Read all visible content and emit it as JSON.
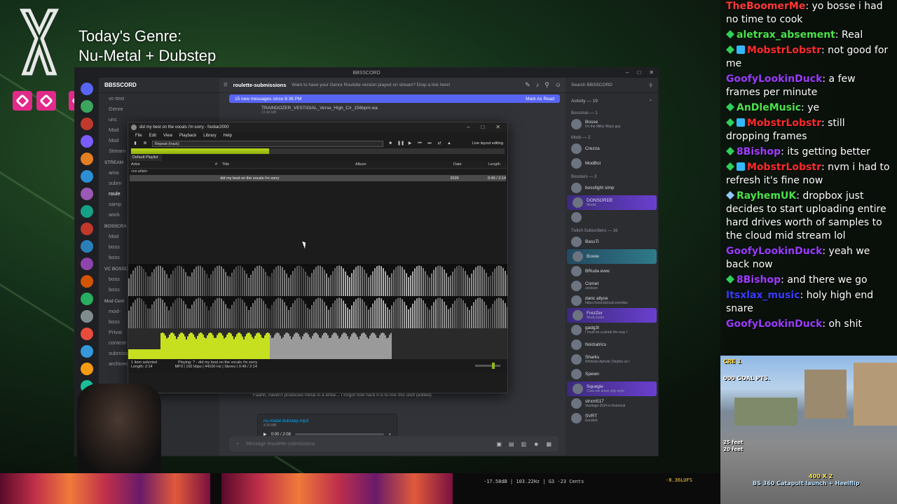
{
  "overlay": {
    "genre_line1": "Today's Genre:",
    "genre_line2": "Nu-Metal + Dubstep"
  },
  "discord": {
    "window_title": "BBSSCORD",
    "server_name": "BBSSCORD",
    "channels": [
      {
        "label": "vc-text",
        "cat": false,
        "sel": false
      },
      {
        "label": "Genre",
        "cat": false,
        "sel": false
      },
      {
        "label": "unc",
        "cat": false,
        "sel": false
      },
      {
        "label": "Mod",
        "cat": false,
        "sel": false
      },
      {
        "label": "Mod",
        "cat": false,
        "sel": false
      },
      {
        "label": "Stream",
        "cat": false,
        "sel": false
      },
      {
        "label": "STREAM",
        "cat": true,
        "sel": false
      },
      {
        "label": "ama",
        "cat": false,
        "sel": false
      },
      {
        "label": "subm",
        "cat": false,
        "sel": false
      },
      {
        "label": "roule",
        "cat": false,
        "sel": true
      },
      {
        "label": "samp",
        "cat": false,
        "sel": false
      },
      {
        "label": "work",
        "cat": false,
        "sel": false
      },
      {
        "label": "BOSSCRA",
        "cat": true,
        "sel": false
      },
      {
        "label": "Mod",
        "cat": false,
        "sel": false
      },
      {
        "label": "boss",
        "cat": false,
        "sel": false
      },
      {
        "label": "boss",
        "cat": false,
        "sel": false
      },
      {
        "label": "VC BOSSC",
        "cat": true,
        "sel": false
      },
      {
        "label": "boss",
        "cat": false,
        "sel": false
      },
      {
        "label": "boss",
        "cat": false,
        "sel": false
      },
      {
        "label": "Mod Cent",
        "cat": true,
        "sel": false
      },
      {
        "label": "mod-",
        "cat": false,
        "sel": false
      },
      {
        "label": "boss",
        "cat": false,
        "sel": false
      },
      {
        "label": "Privat",
        "cat": false,
        "sel": false
      },
      {
        "label": "contest-milkyways",
        "cat": false,
        "sel": false
      },
      {
        "label": "submissions_archived",
        "cat": false,
        "sel": false
      },
      {
        "label": "archived",
        "cat": false,
        "sel": false
      }
    ],
    "channel_name": "roulette-submissions",
    "channel_topic": "Want to have your Genre Roulette version played on stream? Drop a link here!",
    "new_messages": "15 new messages since 8:36 PM",
    "mark_as_read": "Mark As Read",
    "attachment_name": "TRAINDOZER_VESTIGIAL_Verse_High_C#_156bpm.wa",
    "attachment_size": "13.46 MB",
    "message_text": "Faahh, haven't produced metal in a while... I forgot how hard it is to mix this stuff",
    "message_edited": "(edited)",
    "audio_name": "nu metal dubstep.mp3",
    "audio_size": "4.90 MB",
    "audio_time": "0:00 / 2:08",
    "composer_placeholder": "Message #roulette-submissions",
    "search_placeholder": "Search BBSSCORD",
    "activity": "Activity — 19",
    "groups": {
      "bossman": "Bossman — 1",
      "mods": "Mods — 2",
      "boosters": "Boosters — 3",
      "subs": "Twitch Subscribers — 16"
    },
    "members_top": [
      {
        "name": "Bosse",
        "sub": "It's the Milky Ways guy",
        "hl": ""
      }
    ],
    "members_mods": [
      {
        "name": "Crezza",
        "sub": "",
        "hl": ""
      },
      {
        "name": "ModBoi",
        "sub": "",
        "hl": ""
      }
    ],
    "members_boost": [
      {
        "name": "bossfight simp",
        "sub": "",
        "hl": ""
      },
      {
        "name": "DONSORDE",
        "sub": "Medal",
        "hl": "hl"
      },
      {
        "name": "",
        "sub": "",
        "hl": ""
      }
    ],
    "members_subs": [
      {
        "name": "BassTi",
        "sub": "",
        "hl": ""
      },
      {
        "name": "Bowie",
        "sub": "",
        "hl": "hl2"
      },
      {
        "name": "BRuda eww",
        "sub": "",
        "hl": ""
      },
      {
        "name": "Comet",
        "sub": "unclean",
        "hl": ""
      },
      {
        "name": "daric allyce",
        "sub": "https://soundcloud.com/dav",
        "hl": ""
      },
      {
        "name": "FrezZer",
        "sub": "ModLoader",
        "hl": "hl"
      },
      {
        "name": "gadg3t",
        "sub": "I must be a pirate the way I",
        "hl": ""
      },
      {
        "name": "Noiziatrics",
        "sub": "",
        "hl": ""
      },
      {
        "name": "Sharks",
        "sub": "Whitelist Aphotic Depths on r",
        "hl": ""
      },
      {
        "name": "Spewn",
        "sub": "",
        "hl": ""
      },
      {
        "name": "Squegie",
        "sub": "Click me down silly style",
        "hl": "hl"
      },
      {
        "name": "strxm517",
        "sub": "Vaultage DG4 is historical",
        "hl": ""
      },
      {
        "name": "SVRT",
        "sub": "Eurobot",
        "hl": ""
      }
    ]
  },
  "foobar": {
    "title": "did my best on the vocals i'm sorry - foobar2000",
    "menu": [
      "File",
      "Edit",
      "View",
      "Playback",
      "Library",
      "Help"
    ],
    "order": "Repeat (track)",
    "live_layout": "Live layout editing",
    "playlist_tab": "Default Playlist",
    "columns": [
      "Artist",
      "#",
      "Title",
      "Album",
      "Date",
      "Length"
    ],
    "group": "<no artist>",
    "track_title": "did my best on the vocals i'm sorry",
    "track_date": "2026",
    "track_length": "0:49 / 2:14",
    "progress": 0.37,
    "status_left_1": "1 item selected",
    "status_left_2": "Length: 2:14",
    "status_playing": "Playing: ? - did my best on the vocals i'm sorry",
    "status_info": "MP3 | 192 kbps | 44100 Hz | Stereo | 0:49 / 2:14"
  },
  "twitch_chat": [
    {
      "badges": [],
      "user": "TheBoomerMe",
      "color": "#ff3838",
      "text": "yo bosse i had no time to cook"
    },
    {
      "badges": [
        "green"
      ],
      "user": "aletrax_absement",
      "color": "#4be34b",
      "text": "Real"
    },
    {
      "badges": [
        "green",
        "blue"
      ],
      "user": "MobstrLobstr",
      "color": "#ff2a2a",
      "text": "not good for me"
    },
    {
      "badges": [],
      "user": "GoofyLookinDuck",
      "color": "#9a3cff",
      "text": "a few frames per minute"
    },
    {
      "badges": [
        "green"
      ],
      "user": "AnDleMusic",
      "color": "#4be34b",
      "text": "ye"
    },
    {
      "badges": [
        "green",
        "blue"
      ],
      "user": "MobstrLobstr",
      "color": "#ff2a2a",
      "text": "still dropping frames"
    },
    {
      "badges": [
        "green"
      ],
      "user": "8Bishop",
      "color": "#a13cff",
      "text": "its getting better"
    },
    {
      "badges": [
        "green",
        "blue"
      ],
      "user": "MobstrLobstr",
      "color": "#ff2a2a",
      "text": "nvm i had to refresh it's fine now"
    },
    {
      "badges": [
        "dia"
      ],
      "user": "RayhemUK",
      "color": "#4be34b",
      "text": "dropbox just decides to start uploading entire hard drives worth of samples to the cloud mid stream lol"
    },
    {
      "badges": [],
      "user": "GoofyLookinDuck",
      "color": "#9a3cff",
      "text": "yeah we back now"
    },
    {
      "badges": [
        "green"
      ],
      "user": "8Bishop",
      "color": "#a13cff",
      "text": "and there we go"
    },
    {
      "badges": [],
      "user": "Itsxlax_music",
      "color": "#3a3cff",
      "text": "holy high end snare"
    },
    {
      "badges": [],
      "user": "GoofyLookinDuck",
      "color": "#9a3cff",
      "text": "oh shit"
    }
  ],
  "game": {
    "score": "000 GOAL PTS.",
    "feet_1": "25 feet",
    "feet_2": "20 feet",
    "combo": "400 X 2",
    "trick": "BS 360 Catapult launch + Heelflip"
  },
  "meter_text": "-17.58dB | 103.22Hz | G3 -23 Cents",
  "meter_db": "-8.36LUFS"
}
